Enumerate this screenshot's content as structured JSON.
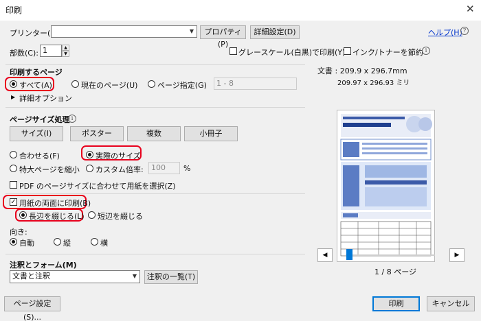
{
  "title": "印刷",
  "printer": {
    "label": "プリンター(N):",
    "value": "",
    "properties": "プロパティ(P)",
    "advanced": "詳細設定(D)",
    "help": "ヘルプ(H)"
  },
  "copies": {
    "label": "部数(C):",
    "value": "1",
    "grayscale": "グレースケール(白黒)で印刷(Y)",
    "save_ink": "インク/トナーを節約"
  },
  "pages": {
    "title": "印刷するページ",
    "all": "すべて(A)",
    "current": "現在のページ(U)",
    "range": "ページ指定(G)",
    "range_value": "1 - 8",
    "more": "詳細オプション"
  },
  "sizing": {
    "title": "ページサイズ処理",
    "tabs": [
      "サイズ(I)",
      "ポスター",
      "複数",
      "小冊子"
    ],
    "fit": "合わせる(F)",
    "actual": "実際のサイズ",
    "shrink": "特大ページを縮小",
    "custom": "カスタム倍率:",
    "custom_value": "100",
    "percent": "%",
    "pdf_size": "PDF のページサイズに合わせて用紙を選択(Z)"
  },
  "duplex": {
    "both_sides": "用紙の両面に印刷(B)",
    "long": "長辺を綴じる(L)",
    "short": "短辺を綴じる"
  },
  "orientation": {
    "title": "向き:",
    "auto": "自動",
    "portrait": "縦",
    "landscape": "横"
  },
  "comments": {
    "title": "注釈とフォーム(M)",
    "value": "文書と注釈",
    "summary": "注釈の一覧(T)"
  },
  "preview": {
    "doc": "文書 : 209.9 x 296.7mm",
    "paper": "209.97 x 296.93 ミリ",
    "page": "1 / 8 ページ"
  },
  "buttons": {
    "page_setup": "ページ設定(S)...",
    "print": "印刷",
    "cancel": "キャンセル"
  },
  "colors": {
    "accent": "#0078d7",
    "highlight": "#e8001c"
  }
}
